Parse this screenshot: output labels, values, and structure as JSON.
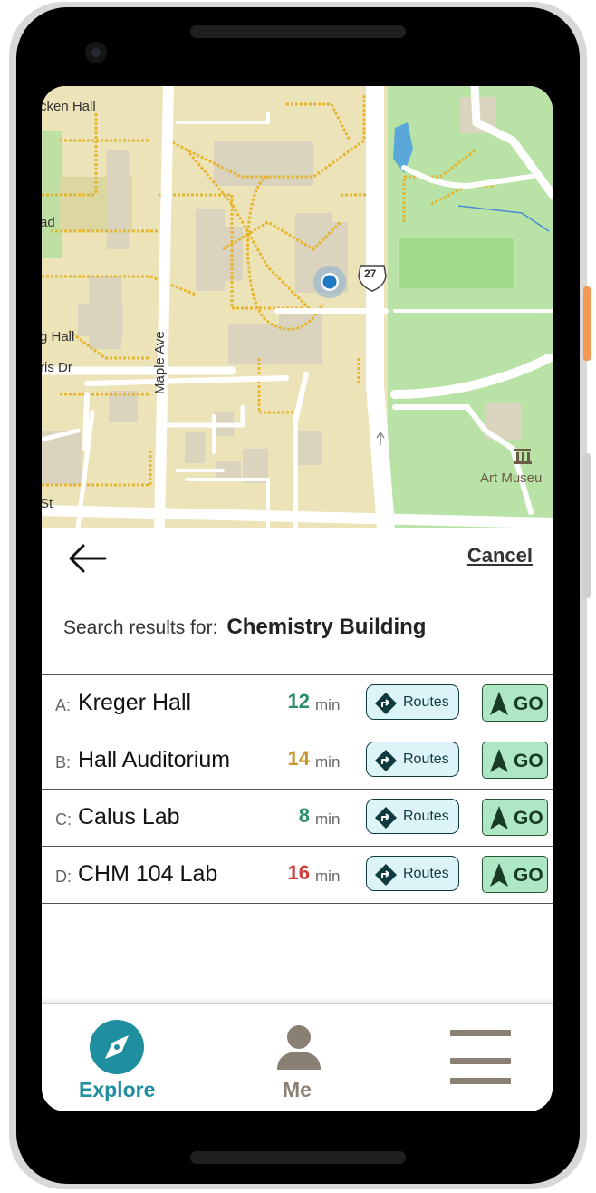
{
  "map": {
    "labels": {
      "kecken_hall": "cken Hall",
      "ad": "ad",
      "g_hall": "g Hall",
      "ris_dr": "ris Dr",
      "maple_ave": "Maple Ave",
      "route_number": "27",
      "art_museum": "Art Museu",
      "st": "St"
    }
  },
  "panel": {
    "cancel_label": "Cancel",
    "search_prefix": "Search results for:",
    "search_query": "Chemistry Building",
    "unit": "min",
    "routes_label": "Routes",
    "go_label": "GO",
    "results": [
      {
        "letter": "A:",
        "name": "Kreger Hall",
        "minutes": "12",
        "color": "#2a8f64"
      },
      {
        "letter": "B:",
        "name": "Hall Auditorium",
        "minutes": "14",
        "color": "#c8962b"
      },
      {
        "letter": "C:",
        "name": "Calus Lab",
        "minutes": "8",
        "color": "#2a8f64"
      },
      {
        "letter": "D:",
        "name": "CHM 104 Lab",
        "minutes": "16",
        "color": "#d33a3a"
      }
    ]
  },
  "tabs": {
    "explore": "Explore",
    "me": "Me"
  },
  "colors": {
    "accent": "#1f8fa0",
    "tab_inactive": "#8a7f73"
  },
  "icons": {
    "back": "arrow-left-icon",
    "routes": "route-diamond-icon",
    "go": "navigation-arrow-icon",
    "explore": "compass-icon",
    "me": "person-icon",
    "menu": "hamburger-menu-icon"
  }
}
